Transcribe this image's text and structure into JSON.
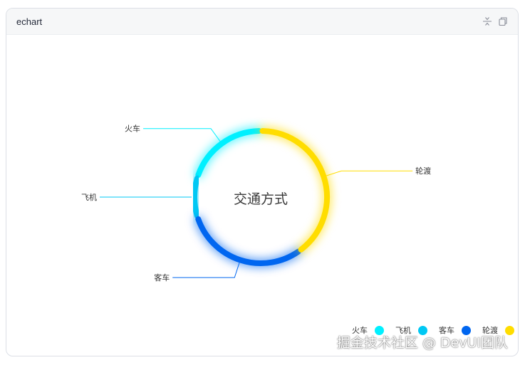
{
  "card": {
    "title": "echart",
    "collapse_icon": "collapse-icon",
    "copy_icon": "copy-icon"
  },
  "chart_data": {
    "type": "pie",
    "center_label": "交通方式",
    "slices": [
      {
        "name": "火车",
        "value": 20,
        "color": "#00f0ff"
      },
      {
        "name": "飞机",
        "value": 10,
        "color": "#00c8f4"
      },
      {
        "name": "客车",
        "value": 30,
        "color": "#0066f0"
      },
      {
        "name": "轮渡",
        "value": 40,
        "color": "#ffdd00"
      }
    ],
    "legend_position": "bottom-right",
    "start_angle_deg": 0,
    "direction": "counterclockwise-from-top"
  },
  "watermark": "掘金技术社区 @ DevUI团队"
}
